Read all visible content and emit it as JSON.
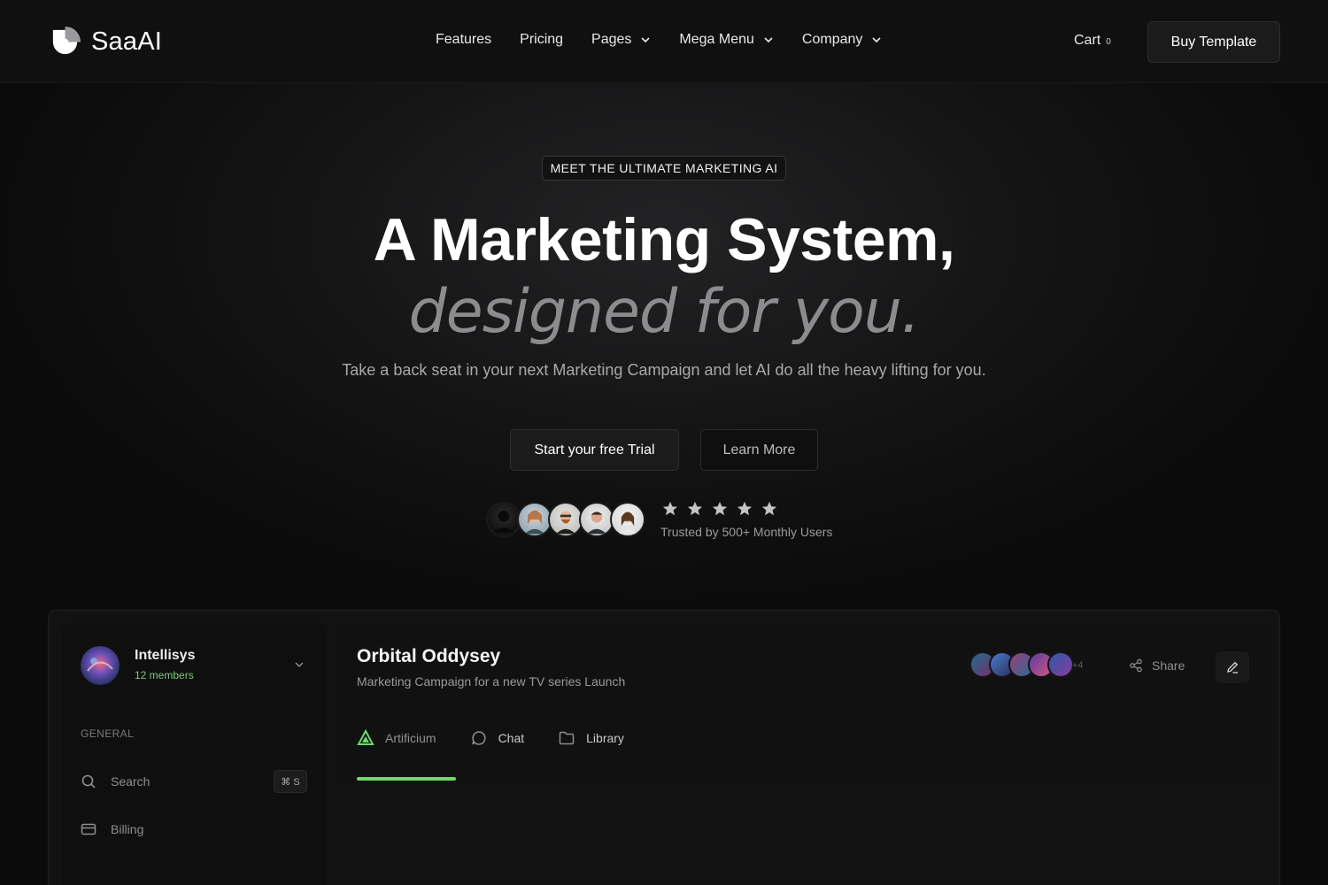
{
  "nav": {
    "brand": "SaaAI",
    "links": [
      {
        "label": "Features",
        "has_dropdown": false
      },
      {
        "label": "Pricing",
        "has_dropdown": false
      },
      {
        "label": "Pages",
        "has_dropdown": true
      },
      {
        "label": "Mega Menu",
        "has_dropdown": true
      },
      {
        "label": "Company",
        "has_dropdown": true
      }
    ],
    "cart_label": "Cart",
    "cart_count": "0",
    "buy_label": "Buy Template"
  },
  "hero": {
    "badge": "MEET THE ULTIMATE MARKETING AI",
    "headline": "A Marketing System,",
    "headline_sub": "designed for you.",
    "lead": "Take a back seat in your next Marketing Campaign and let AI do all the heavy lifting for you.",
    "cta_primary": "Start your free Trial",
    "cta_secondary": "Learn More",
    "rating_stars": 5,
    "trust_text": "Trusted by 500+ Monthly Users"
  },
  "preview": {
    "workspace_name": "Intellisys",
    "workspace_members": "12 members",
    "sidebar_section": "GENERAL",
    "sidebar_items": [
      {
        "label": "Search",
        "icon": "search-icon",
        "shortcut": "⌘ S"
      },
      {
        "label": "Billing",
        "icon": "credit-card-icon"
      }
    ],
    "project_title": "Orbital Oddysey",
    "project_desc": "Marketing Campaign for a new TV series Launch",
    "members_more": "+4",
    "share_label": "Share",
    "tabs": [
      {
        "label": "Artificium",
        "icon": "triangle-logo-icon",
        "active": true
      },
      {
        "label": "Chat",
        "icon": "chat-bubble-icon",
        "active": false
      },
      {
        "label": "Library",
        "icon": "folder-icon",
        "active": false
      }
    ]
  },
  "colors": {
    "background": "#0b0b0c",
    "accent_green": "#6ed86a",
    "muted_text": "#8c8c8e"
  }
}
